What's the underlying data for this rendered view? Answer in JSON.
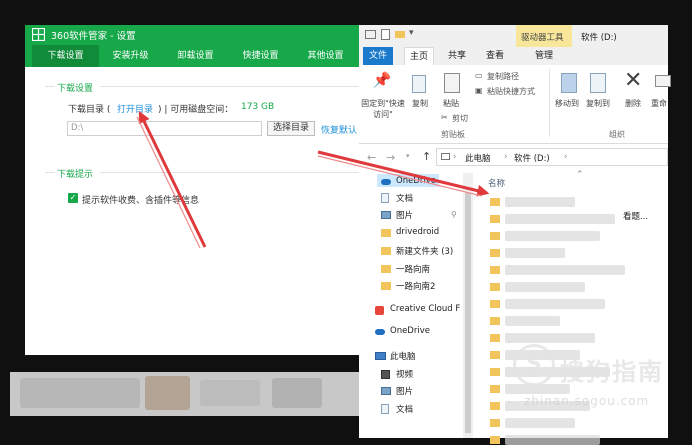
{
  "settings_window": {
    "title": "360软件管家 - 设置",
    "tabs": [
      "下载设置",
      "安装升级",
      "卸载设置",
      "快捷设置",
      "其他设置"
    ],
    "active_tab": 0,
    "download_group": {
      "title": "下载设置",
      "dir_label": "下载目录 (",
      "open_dir_link": "打开目录",
      "separator": ") | 可用磁盘空间：",
      "free_space": "173 GB",
      "path_value": "D:\\",
      "choose_dir_button": "选择目录",
      "restore_default_link": "恢复默认"
    },
    "tips_group": {
      "title": "下载提示",
      "checkbox_label": "提示软件收费、含插件等信息",
      "checked": true
    }
  },
  "explorer_window": {
    "title_context_tab": "驱动器工具",
    "title": "软件 (D:)",
    "ribbon_tabs": [
      "文件",
      "主页",
      "共享",
      "查看",
      "管理"
    ],
    "clipboard": {
      "pin_label": "固定到\"快速访问\"",
      "copy_label": "复制",
      "paste_label": "粘贴",
      "copy_path": "复制路径",
      "paste_shortcut": "粘贴快捷方式",
      "cut": "剪切",
      "group_label": "剪贴板"
    },
    "organize": {
      "move_to": "移动到",
      "copy_to": "复制到",
      "delete": "删除",
      "rename": "重命",
      "group_label": "组织"
    },
    "breadcrumb": [
      "此电脑",
      "软件 (D:)"
    ],
    "nav_items": [
      {
        "label": "OneDrive",
        "icon": "cloud-icon",
        "indent": 1
      },
      {
        "label": "文档",
        "icon": "document-icon",
        "indent": 1
      },
      {
        "label": "图片",
        "icon": "picture-icon",
        "indent": 1
      },
      {
        "label": "drivedroid",
        "icon": "folder-icon",
        "indent": 1
      },
      {
        "label": "新建文件夹 (3)",
        "icon": "folder-icon",
        "indent": 1
      },
      {
        "label": "一路向南",
        "icon": "folder-icon",
        "indent": 1
      },
      {
        "label": "一路向南2",
        "icon": "folder-icon",
        "indent": 1
      },
      {
        "label": "Creative Cloud F",
        "icon": "creative-cloud-icon",
        "indent": 0
      },
      {
        "label": "OneDrive",
        "icon": "cloud-icon",
        "indent": 0
      },
      {
        "label": "此电脑",
        "icon": "computer-icon",
        "indent": 0
      },
      {
        "label": "视频",
        "icon": "video-icon",
        "indent": 1
      },
      {
        "label": "图片",
        "icon": "picture-icon",
        "indent": 1
      },
      {
        "label": "文档",
        "icon": "document-icon",
        "indent": 1
      }
    ],
    "column_header": "名称",
    "partial_item_text": "看题..."
  },
  "watermark": {
    "brand": "搜狗指南",
    "url": "zhinan.sogou.com"
  },
  "colors": {
    "brand_green": "#17a84a",
    "link_blue": "#1e8fd8",
    "arrow_red": "#e0393c",
    "file_tab_blue": "#1979ca"
  }
}
